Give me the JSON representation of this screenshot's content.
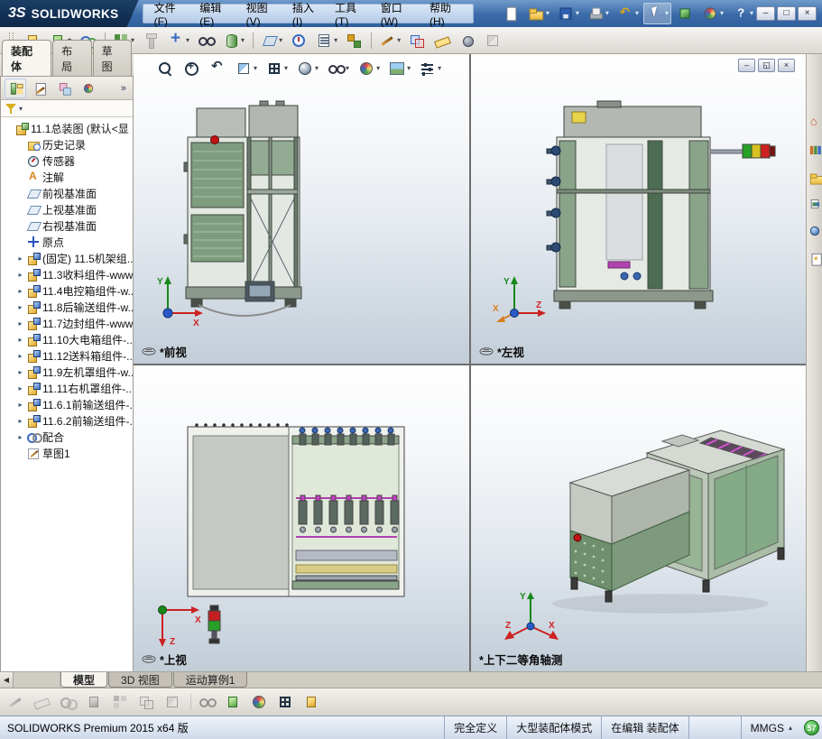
{
  "titlebar": {
    "logo_mark": "3S",
    "app_name": "SOLIDWORKS",
    "menus": [
      "文件(F)",
      "编辑(E)",
      "视图(V)",
      "插入(I)",
      "工具(T)",
      "窗口(W)",
      "帮助(H)"
    ],
    "tools": [
      {
        "name": "new-document-button",
        "icon": "page-white"
      },
      {
        "name": "open-document-button",
        "icon": "folder-yellow",
        "dd": true
      },
      {
        "name": "save-button",
        "icon": "floppy-blue",
        "dd": true
      },
      {
        "name": "print-button",
        "icon": "printer-gray",
        "dd": true
      },
      {
        "name": "undo-button",
        "icon": "undo-yellow",
        "dd": true
      },
      {
        "name": "select-button",
        "icon": "cursor-white",
        "dd": true,
        "active": true
      },
      {
        "name": "rebuild-button",
        "icon": "rebuild-cube"
      },
      {
        "name": "options-button",
        "icon": "ball-multi",
        "dd": true
      },
      {
        "name": "help-button",
        "icon": "question-mark",
        "dd": true
      }
    ],
    "window_buttons": [
      {
        "name": "minimize-button",
        "glyph": "–"
      },
      {
        "name": "maximize-button",
        "glyph": "□"
      },
      {
        "name": "close-button",
        "glyph": "×"
      }
    ]
  },
  "toolbar": {
    "tools": [
      {
        "name": "edit-component-button",
        "icon": "cube-yellow"
      },
      {
        "name": "insert-components-button",
        "icon": "cube-green",
        "dd": true
      },
      {
        "name": "mate-button",
        "icon": "mate-clips"
      },
      {
        "name": "linear-component-pattern-button",
        "icon": "pattern-grid",
        "dd": true,
        "sep": true
      },
      {
        "name": "smart-fasteners-button",
        "icon": "fastener-bolt",
        "disabled": true
      },
      {
        "name": "move-component-button",
        "icon": "move-arrows",
        "dd": true
      },
      {
        "name": "show-hidden-components-button",
        "icon": "glasses-hs"
      },
      {
        "name": "assembly-features-button",
        "icon": "feature-boss",
        "dd": true
      },
      {
        "name": "reference-geometry-button",
        "icon": "refgeo-plane",
        "dd": true,
        "sep": true
      },
      {
        "name": "new-motion-study-button",
        "icon": "motion-clock"
      },
      {
        "name": "bill-of-materials-button",
        "icon": "bom-table",
        "dd": true
      },
      {
        "name": "exploded-view-button",
        "icon": "explode-view"
      },
      {
        "name": "explode-line-sketch-button",
        "icon": "sketch-pencil",
        "dd": true,
        "sep": true
      },
      {
        "name": "interference-detection-button",
        "icon": "interference"
      },
      {
        "name": "measure-button",
        "icon": "measure-ruler"
      },
      {
        "name": "mass-properties-button",
        "icon": "massprops-ball"
      },
      {
        "name": "section-properties-button",
        "icon": "section-cut",
        "disabled": true
      }
    ]
  },
  "cm_tabs": [
    {
      "label": "装配体",
      "active": true
    },
    {
      "label": "布局"
    },
    {
      "label": "草图"
    }
  ],
  "panel_tabs": [
    {
      "name": "featuremanager-tree-tab",
      "icon": "fm-tree-icon",
      "active": true
    },
    {
      "name": "propertymanager-tab",
      "icon": "prop-icon"
    },
    {
      "name": "configurationmanager-tab",
      "icon": "config-icon"
    },
    {
      "name": "displaymanager-tab",
      "icon": "ball-multi"
    }
  ],
  "panel_chevron": "»",
  "filter": {
    "caret": "▾"
  },
  "tree": {
    "items": [
      {
        "name": "tree-item-root",
        "label": "11.1总装图 (默认<显",
        "icon": "assembly-root-icon",
        "expander": "",
        "lv": "lv0"
      },
      {
        "name": "tree-item-history",
        "label": "历史记录",
        "icon": "history-folder-icon",
        "expander": "",
        "lv": "lv1"
      },
      {
        "name": "tree-item-sensors",
        "label": "传感器",
        "icon": "sensor-icon",
        "expander": "",
        "lv": "lv1"
      },
      {
        "name": "tree-item-annotations",
        "label": "注解",
        "icon": "annotations-icon",
        "expander": "",
        "lv": "lv1"
      },
      {
        "name": "tree-item-front-plane",
        "label": "前视基准面",
        "icon": "plane-icon",
        "expander": "",
        "lv": "lv1"
      },
      {
        "name": "tree-item-top-plane",
        "label": "上视基准面",
        "icon": "plane-icon",
        "expander": "",
        "lv": "lv1"
      },
      {
        "name": "tree-item-right-plane",
        "label": "右视基准面",
        "icon": "plane-icon",
        "expander": "",
        "lv": "lv1"
      },
      {
        "name": "tree-item-origin",
        "label": "原点",
        "icon": "origin-icon",
        "expander": "",
        "lv": "lv1"
      },
      {
        "name": "tree-item-frame-assembly",
        "label": "(固定) 11.5机架组...",
        "icon": "component-icon",
        "expander": "▸",
        "lv": "lv1"
      },
      {
        "name": "tree-item-collect-assembly",
        "label": "11.3收料组件-www",
        "icon": "component-icon",
        "expander": "▸",
        "lv": "lv1"
      },
      {
        "name": "tree-item-control-box-assembly",
        "label": "11.4电控箱组件-w...",
        "icon": "component-icon",
        "expander": "▸",
        "lv": "lv1"
      },
      {
        "name": "tree-item-rear-conveyor-assembly",
        "label": "11.8后输送组件-w...",
        "icon": "component-icon",
        "expander": "▸",
        "lv": "lv1"
      },
      {
        "name": "tree-item-edge-seal-assembly",
        "label": "11.7边封组件-www",
        "icon": "component-icon",
        "expander": "▸",
        "lv": "lv1"
      },
      {
        "name": "tree-item-main-ebox-assembly",
        "label": "11.10大电箱组件-...",
        "icon": "component-icon",
        "expander": "▸",
        "lv": "lv1"
      },
      {
        "name": "tree-item-feed-box-assembly",
        "label": "11.12送料箱组件-...",
        "icon": "component-icon",
        "expander": "▸",
        "lv": "lv1"
      },
      {
        "name": "tree-item-left-cover-assembly",
        "label": "11.9左机罩组件-w...",
        "icon": "component-icon",
        "expander": "▸",
        "lv": "lv1"
      },
      {
        "name": "tree-item-right-cover-assembly",
        "label": "11.11右机罩组件-...",
        "icon": "component-icon",
        "expander": "▸",
        "lv": "lv1"
      },
      {
        "name": "tree-item-front-conveyor1-assembly",
        "label": "11.6.1前输送组件-...",
        "icon": "component-icon",
        "expander": "▸",
        "lv": "lv1"
      },
      {
        "name": "tree-item-front-conveyor2-assembly",
        "label": "11.6.2前输送组件-...",
        "icon": "component-icon",
        "expander": "▸",
        "lv": "lv1"
      },
      {
        "name": "tree-item-mates",
        "label": "配合",
        "icon": "mates-icon",
        "expander": "▸",
        "lv": "lv1"
      },
      {
        "name": "tree-item-sketch1",
        "label": "草图1",
        "icon": "sketch-icon",
        "expander": "",
        "lv": "lv1"
      }
    ]
  },
  "headsup": {
    "tools": [
      {
        "name": "zoom-fit-button",
        "icon": "magnifier"
      },
      {
        "name": "zoom-area-button",
        "icon": "magnifier-plus"
      },
      {
        "name": "previous-view-button",
        "icon": "undo-navy"
      },
      {
        "name": "section-view-button",
        "icon": "section-cut",
        "dd": true
      },
      {
        "name": "view-orientation-button",
        "icon": "orientation-cube",
        "dd": true
      },
      {
        "name": "display-style-button",
        "icon": "display-sphere",
        "dd": true
      },
      {
        "name": "hide-show-items-button",
        "icon": "glasses-hs",
        "dd": true
      },
      {
        "name": "edit-appearance-button",
        "icon": "ball-multi",
        "dd": true
      },
      {
        "name": "apply-scene-button",
        "icon": "scene-photo",
        "dd": true
      },
      {
        "name": "view-settings-button",
        "icon": "settings-sliders",
        "dd": true
      }
    ]
  },
  "doc_buttons": [
    {
      "name": "document-minimize-button",
      "glyph": "–"
    },
    {
      "name": "document-restore-button",
      "glyph": "◱"
    },
    {
      "name": "document-close-button",
      "glyph": "×"
    }
  ],
  "viewports": [
    {
      "label": "*前视",
      "axes": {
        "v": "Y",
        "h": "X"
      }
    },
    {
      "label": "*左视",
      "axes": {
        "v": "Y",
        "h": "Z",
        "x2": "X"
      }
    },
    {
      "label": "*上视",
      "axes": {
        "h": "X",
        "d": "Z"
      }
    },
    {
      "label": "*上下二等角轴测",
      "axes": {
        "v": "Y",
        "r": "X",
        "l": "Z"
      }
    }
  ],
  "task_pane": {
    "tools": [
      {
        "name": "solidworks-resources-tab",
        "icon": "home-icon"
      },
      {
        "name": "design-library-tab",
        "icon": "library-icon"
      },
      {
        "name": "file-explorer-tab",
        "icon": "folder-yellow"
      },
      {
        "name": "view-palette-tab",
        "icon": "palette-icon"
      },
      {
        "name": "appearances-scenes-tab",
        "icon": "globe-icon"
      },
      {
        "name": "custom-properties-tab",
        "icon": "props-icon"
      }
    ]
  },
  "bottom_tabs": {
    "arrows": [
      "◀"
    ],
    "tabs": [
      {
        "label": "模型",
        "active": true
      },
      {
        "label": "3D 视图"
      },
      {
        "label": "运动算例1"
      }
    ]
  },
  "bottom_toolbar": {
    "tools": [
      {
        "name": "sketch-button",
        "icon": "sketch-pencil",
        "disabled": true
      },
      {
        "name": "smart-dimension-button",
        "icon": "measure-ruler",
        "disabled": true
      },
      {
        "name": "sketch-relations-button",
        "icon": "mate-clips",
        "disabled": true
      },
      {
        "name": "convert-entities-button",
        "icon": "cube-blue",
        "disabled": true
      },
      {
        "name": "offset-entities-button",
        "icon": "pattern-grid",
        "disabled": true
      },
      {
        "name": "trim-entities-button",
        "icon": "interference",
        "disabled": true
      },
      {
        "name": "mirror-entities-button",
        "icon": "section-cut",
        "disabled": true
      },
      {
        "name": "display-relations-button",
        "icon": "glasses-hs",
        "disabled": true,
        "sep": true
      },
      {
        "name": "isolate-button",
        "icon": "cube-green"
      },
      {
        "name": "edit-appearance-bottom-button",
        "icon": "ball-multi"
      },
      {
        "name": "view-orientation-bottom-button",
        "icon": "orientation-cube"
      },
      {
        "name": "instant3d-button",
        "icon": "cube-yellow"
      }
    ]
  },
  "statusbar": {
    "left": "SOLIDWORKS Premium 2015 x64 版",
    "items": [
      "完全定义",
      "大型装配体模式",
      "在编辑 装配体"
    ],
    "units": "MMGS",
    "units_caret": "▴",
    "badge": "57"
  }
}
